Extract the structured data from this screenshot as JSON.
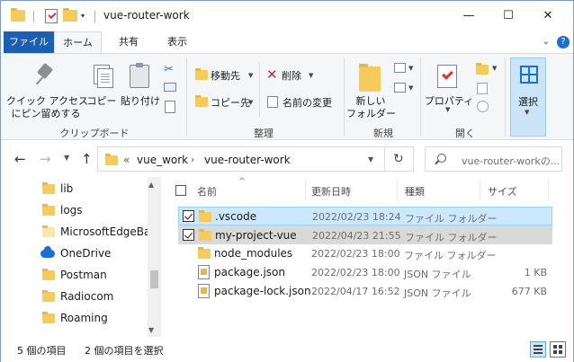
{
  "window": {
    "title": "vue-router-work",
    "controls": {
      "minimize": "—",
      "maximize": "☐",
      "close": "✕"
    }
  },
  "ribbon_tabs": [
    {
      "label": "ファイル"
    },
    {
      "label": "ホーム"
    },
    {
      "label": "共有"
    },
    {
      "label": "表示"
    }
  ],
  "ribbon": {
    "clipboard": {
      "pin_label_1": "クイック アクセス",
      "pin_label_2": "にピン留めする",
      "copy": "コピー",
      "paste": "貼り付け",
      "group": "クリップボード"
    },
    "organize": {
      "move_to": "移動先",
      "copy_to": "コピー先",
      "delete": "削除",
      "rename": "名前の変更",
      "group": "整理"
    },
    "new": {
      "new_folder_1": "新しい",
      "new_folder_2": "フォルダー",
      "group": "新規"
    },
    "open": {
      "properties": "プロパティ",
      "group": "開く"
    },
    "select": {
      "label": "選択"
    }
  },
  "address": {
    "prefix": "«",
    "segments": [
      "vue_work",
      "vue-router-work"
    ],
    "search_placeholder": "vue-router-workの..."
  },
  "nav_pane": {
    "items": [
      {
        "label": "lib",
        "icon": "folder-icon"
      },
      {
        "label": "logs",
        "icon": "folder-icon"
      },
      {
        "label": "MicrosoftEdgeBac",
        "icon": "folder-icon"
      },
      {
        "label": "OneDrive",
        "icon": "onedrive-icon"
      },
      {
        "label": "Postman",
        "icon": "folder-icon"
      },
      {
        "label": "Radiocom",
        "icon": "folder-icon"
      },
      {
        "label": "Roaming",
        "icon": "folder-icon"
      }
    ]
  },
  "file_list": {
    "columns": [
      "名前",
      "更新日時",
      "種類",
      "サイズ"
    ],
    "rows": [
      {
        "name": ".vscode",
        "modified": "2022/02/23 18:24",
        "type": "ファイル フォルダー",
        "size": "",
        "kind": "folder",
        "checked": true,
        "state": "selected-focus"
      },
      {
        "name": "my-project-vue",
        "modified": "2022/04/23 21:55",
        "type": "ファイル フォルダー",
        "size": "",
        "kind": "folder",
        "checked": true,
        "state": "selected"
      },
      {
        "name": "node_modules",
        "modified": "2022/02/23 18:00",
        "type": "ファイル フォルダー",
        "size": "",
        "kind": "folder",
        "checked": false,
        "state": "normal"
      },
      {
        "name": "package.json",
        "modified": "2022/02/23 18:00",
        "type": "JSON ファイル",
        "size": "1 KB",
        "kind": "json",
        "checked": false,
        "state": "normal"
      },
      {
        "name": "package-lock.json",
        "modified": "2022/04/17 16:52",
        "type": "JSON ファイル",
        "size": "677 KB",
        "kind": "json",
        "checked": false,
        "state": "normal"
      }
    ]
  },
  "status_bar": {
    "item_count": "5 個の項目",
    "selected_count": "2 個の項目を選択"
  },
  "colors": {
    "accent": "#1a5fb4",
    "selection": "#cce8ff",
    "folder": "#f5cc5c"
  }
}
